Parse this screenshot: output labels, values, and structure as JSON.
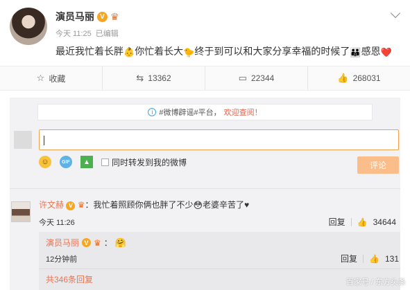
{
  "post": {
    "author": "演员马丽",
    "time": "今天 11:25",
    "edited": "已编辑",
    "text_parts": [
      "最近我忙着长胖",
      "你忙着长大",
      "终于到可以和大家分享幸福的时候了",
      "感恩"
    ],
    "emojis": [
      "👶",
      "🐤",
      "👪",
      "❤️"
    ]
  },
  "actions": {
    "favorite_label": "收藏",
    "repost_count": "13362",
    "comment_count": "22344",
    "like_count": "268031"
  },
  "notice": {
    "prefix": "#微博辟谣#平台，",
    "highlight": "欢迎查阅！"
  },
  "composer": {
    "forward_label": "同时转发到我的微博",
    "submit_label": "评论"
  },
  "comment": {
    "author": "许文赫",
    "text_a": "：我忙着照顾你俩也胖了不少",
    "text_b": "老婆辛苦了",
    "heart": "♥",
    "time": "今天 11:26",
    "reply_label": "回复",
    "like_count": "34644"
  },
  "reply": {
    "author": "演员马丽",
    "text": "：",
    "time": "12分钟前",
    "reply_label": "回复",
    "like_count": "131",
    "more": "共346条回复"
  },
  "watermark": "百家号 / 东方头条",
  "colors": {
    "accent": "#eb7350",
    "vip": "#f5a623",
    "input_border": "#f0a14a",
    "submit_bg": "#fbbe8b"
  }
}
